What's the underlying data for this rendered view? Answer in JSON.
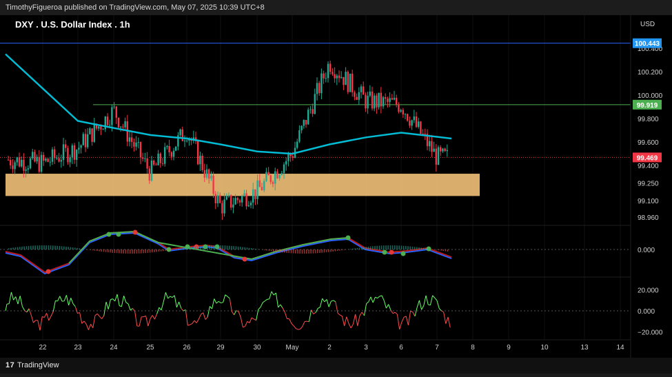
{
  "header": {
    "publisher_line": "TimothyFigueroa published on TradingView.com, May 07, 2025 10:39 UTC+8"
  },
  "footer": {
    "brand": "TradingView",
    "logo_mark": "17"
  },
  "colors": {
    "up_candle": "#22ab94",
    "down_candle": "#f23645",
    "ma_line": "#00bcd4",
    "zone_fill": "#ffcc80",
    "level_line_blue": "#2962ff",
    "level_line_green": "#4caf50",
    "macd_blue": "#2962ff",
    "macd_red": "#b71c1c",
    "osc_up": "#66ff66",
    "osc_down": "#ff4d4d"
  },
  "chart_data": {
    "type": "candlestick",
    "title": "DXY . U.S. Dollar Index . 1h",
    "currency": "USD",
    "x_labels": [
      "22",
      "23",
      "24",
      "25",
      "26",
      "29",
      "30",
      "May",
      "2",
      "3",
      "6",
      "7",
      "8",
      "9",
      "13",
      "14"
    ],
    "x_axis_labels_full": [
      "22",
      "23",
      "24",
      "25",
      "26",
      "29",
      "30",
      "May",
      "2",
      "3",
      "6",
      "7",
      "8",
      "9",
      "10",
      "13",
      "14"
    ],
    "price_axis": {
      "ticks": [
        "100.400",
        "100.200",
        "100.000",
        "99.800",
        "99.600",
        "99.400",
        "99.250",
        "99.100",
        "98.960"
      ],
      "ylim": [
        98.9,
        100.75
      ]
    },
    "price_tags": {
      "blue_level": "100.443",
      "green_level": "99.919",
      "last_price": "99.469"
    },
    "support_zone": [
      99.14,
      99.33
    ],
    "price_series_approx": {
      "x": [
        "22",
        "23",
        "24",
        "25",
        "26",
        "29",
        "30",
        "May",
        "2",
        "3",
        "6",
        "7"
      ],
      "close": [
        99.42,
        99.55,
        99.87,
        99.34,
        99.7,
        99.05,
        99.18,
        99.5,
        100.28,
        99.95,
        99.92,
        99.469
      ]
    },
    "moving_average_approx": {
      "x": [
        "22",
        "23",
        "24",
        "25",
        "26",
        "29",
        "30",
        "May",
        "2",
        "3",
        "6",
        "7"
      ],
      "values": [
        100.35,
        99.78,
        99.72,
        99.66,
        99.63,
        99.58,
        99.52,
        99.5,
        99.58,
        99.64,
        99.68,
        99.63
      ]
    },
    "macd_panel": {
      "tick": "0.000"
    },
    "oscillator_panel": {
      "ticks": [
        "20.000",
        "0.000",
        "−20.000"
      ]
    }
  }
}
